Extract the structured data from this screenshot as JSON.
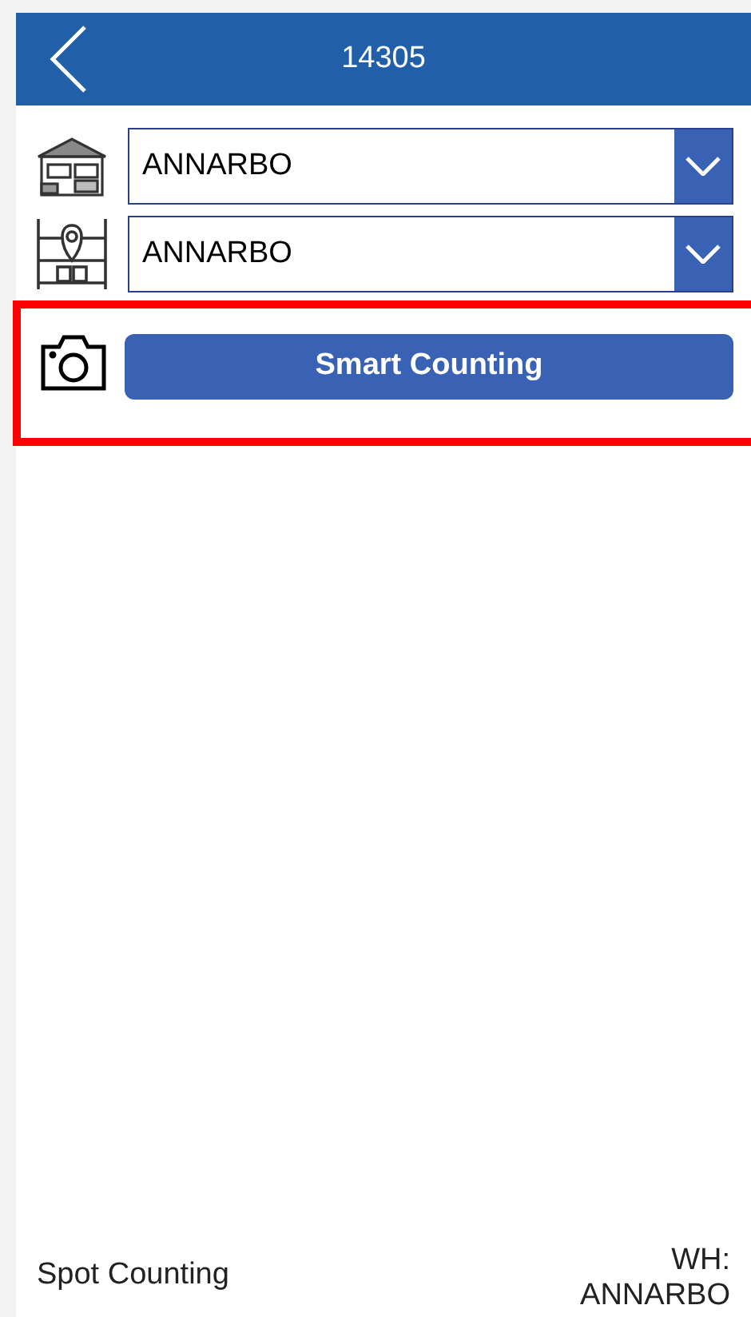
{
  "header": {
    "title": "14305"
  },
  "dropdowns": [
    {
      "kind": "warehouse",
      "value": "ANNARBO"
    },
    {
      "kind": "location",
      "value": "ANNARBO"
    }
  ],
  "smart_button": {
    "label": "Smart Counting"
  },
  "footer": {
    "mode": "Spot Counting",
    "wh_label": "WH:",
    "wh_value": "ANNARBO"
  }
}
